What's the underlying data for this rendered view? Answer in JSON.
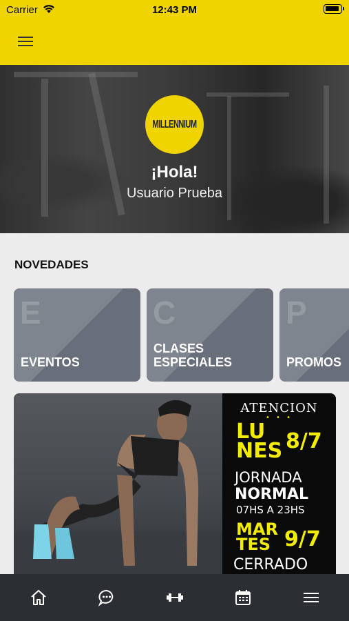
{
  "status_bar": {
    "carrier": "Carrier",
    "time": "12:43 PM",
    "wifi_icon": "wifi-icon",
    "battery_icon": "battery-icon"
  },
  "header": {
    "menu_icon": "hamburger-menu-icon",
    "background": "#efd400"
  },
  "hero": {
    "logo_text": "MILLENNIUM",
    "greeting": "¡Hola!",
    "username": "Usuario Prueba"
  },
  "novedades": {
    "title": "NOVEDADES",
    "cards": [
      {
        "letter": "E",
        "label": "EVENTOS"
      },
      {
        "letter": "C",
        "label": "CLASES ESPECIALES"
      },
      {
        "letter": "P",
        "label": "PROMOS"
      }
    ]
  },
  "banner": {
    "heading": "ATENCION",
    "dots": "• • •",
    "day1": "LU NES",
    "date1": "8/7",
    "line1": "JORNADA",
    "line2": "NORMAL",
    "line3": "07HS A 23HS",
    "day2": "MAR TES",
    "date2": "9/7",
    "line4": "CERRADO"
  },
  "tabbar": {
    "items": [
      {
        "icon": "home-icon"
      },
      {
        "icon": "chat-icon"
      },
      {
        "icon": "dumbbell-icon"
      },
      {
        "icon": "calendar-icon"
      },
      {
        "icon": "menu-icon"
      }
    ]
  },
  "colors": {
    "accent": "#efd400",
    "card": "#6d7480",
    "tabbar": "#2b2e33",
    "poster_yellow": "#f2ec00"
  }
}
